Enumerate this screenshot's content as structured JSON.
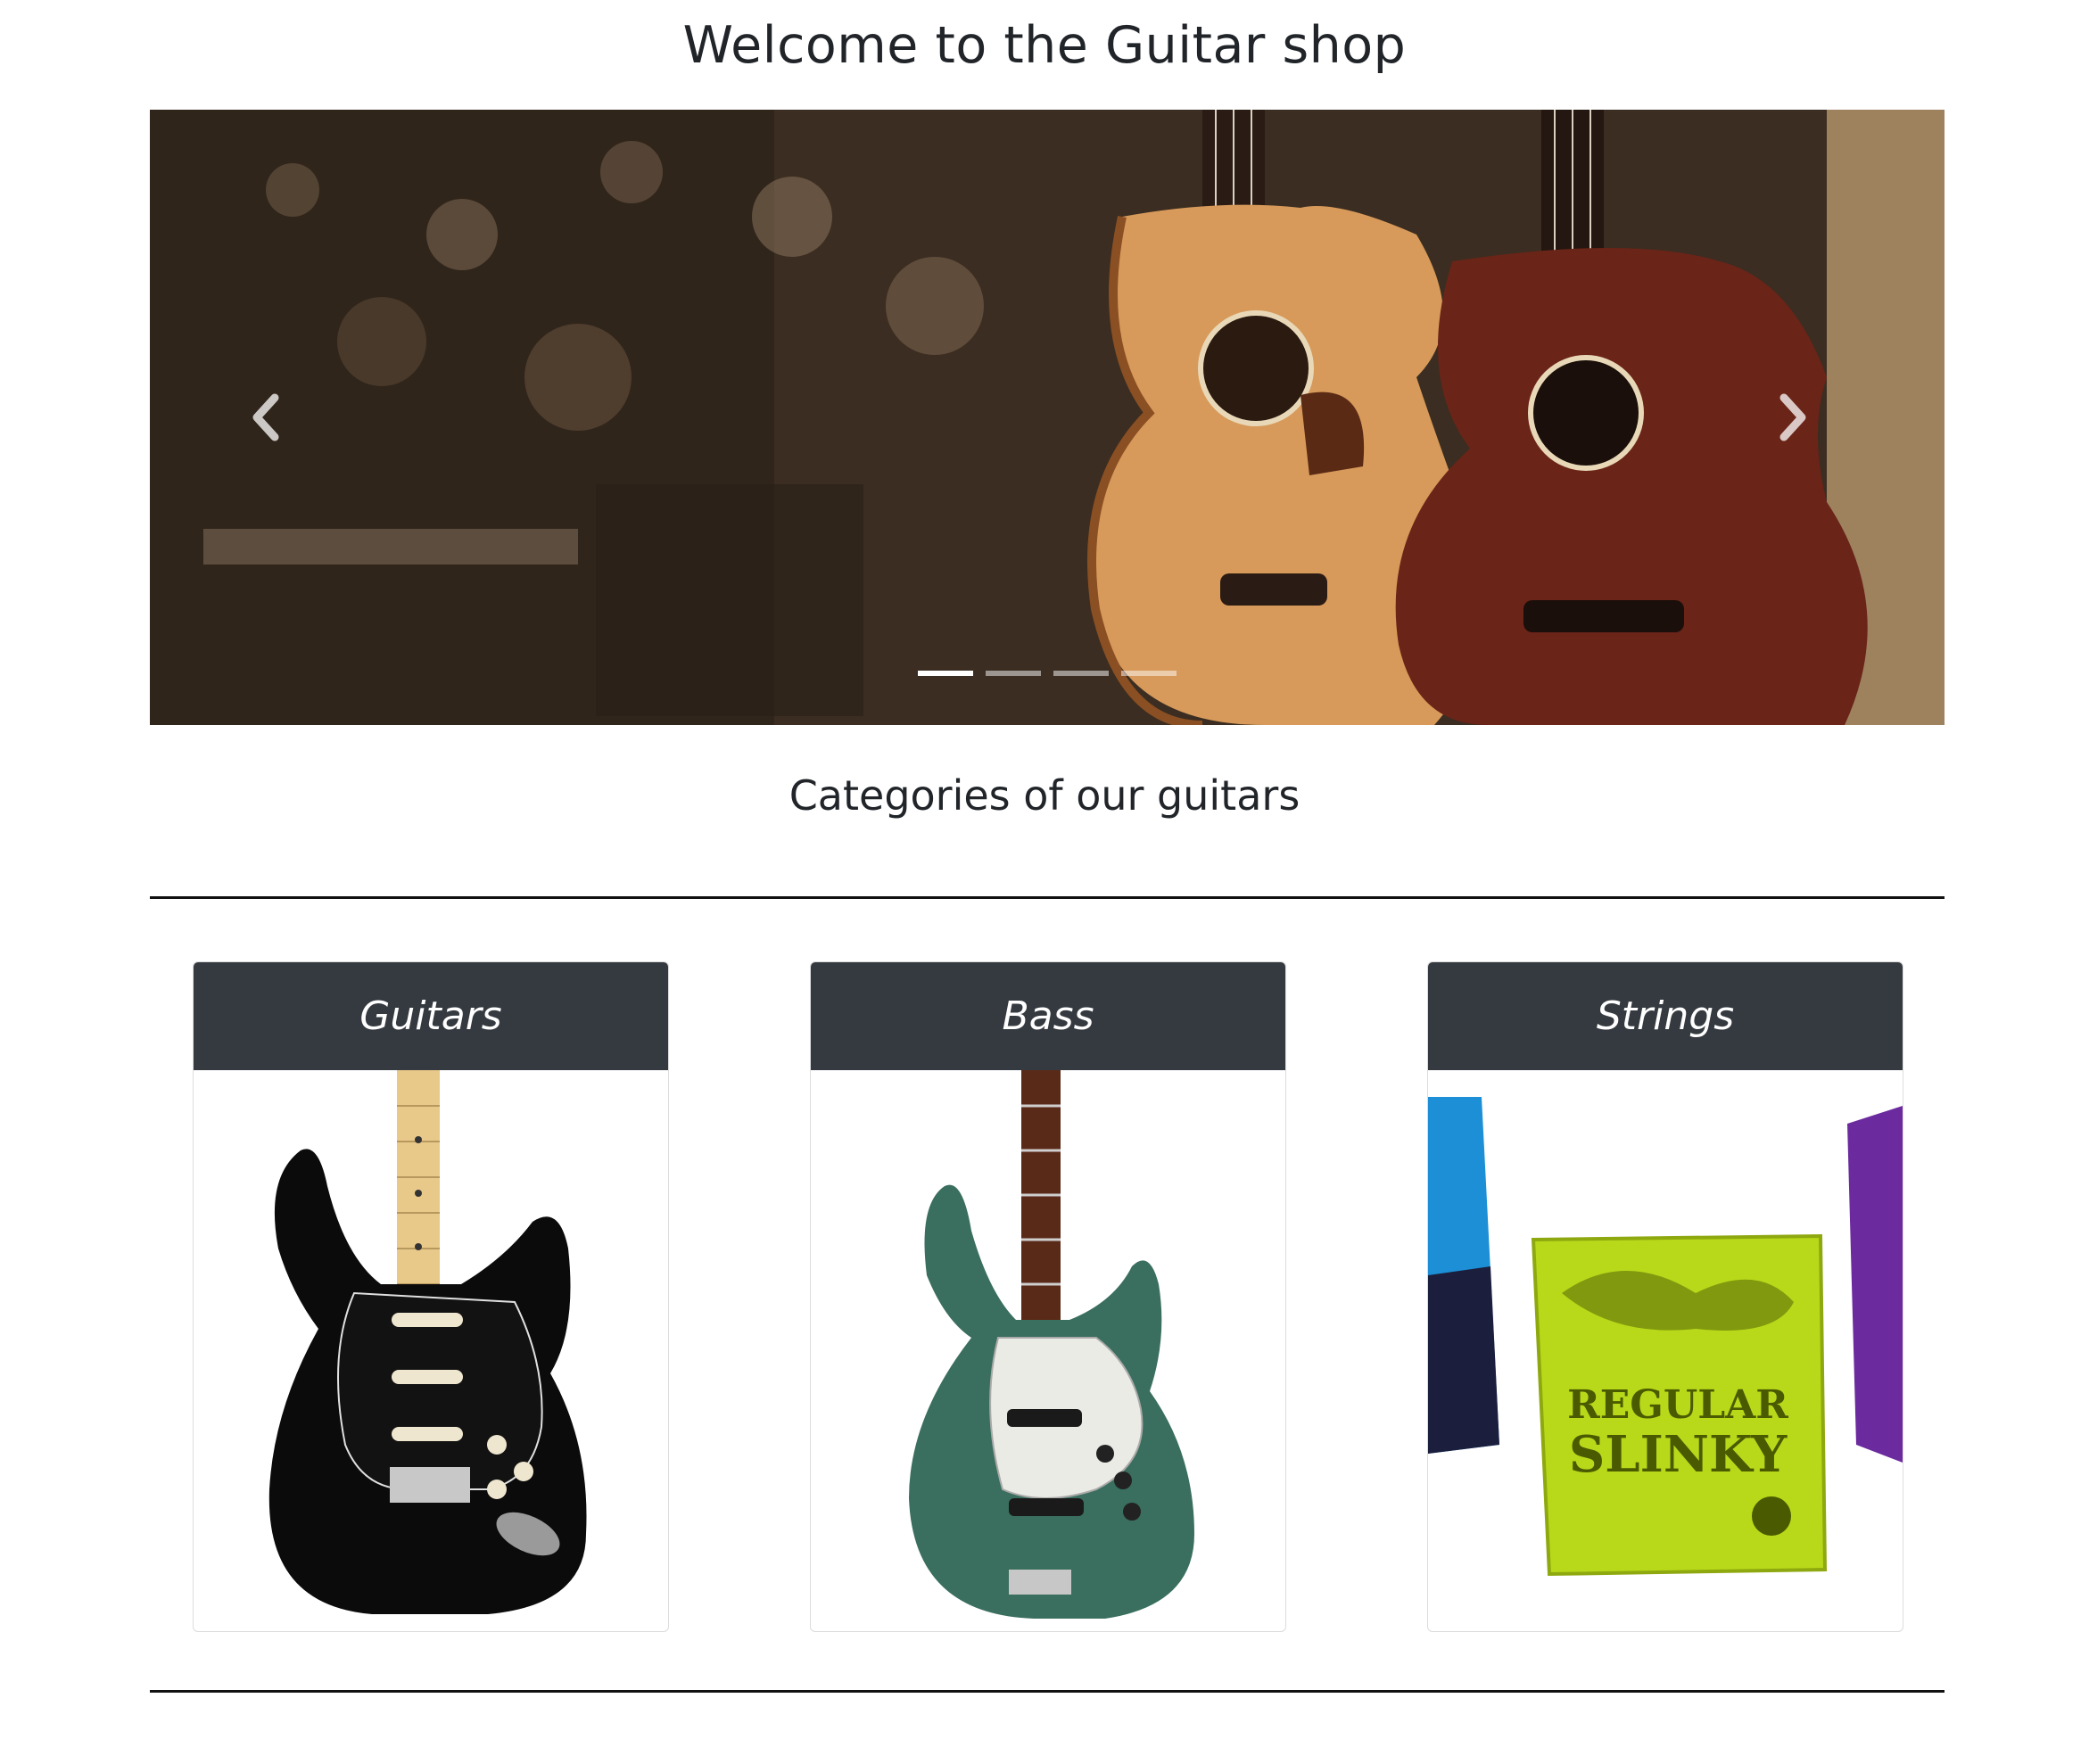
{
  "page": {
    "title": "Welcome to the Guitar shop",
    "categories_heading": "Categories of our guitars"
  },
  "carousel": {
    "prev_icon": "chevron-left-icon",
    "next_icon": "chevron-right-icon",
    "slide_count": 4,
    "active_slide": 1
  },
  "categories": [
    {
      "label": "Guitars"
    },
    {
      "label": "Bass"
    },
    {
      "label": "Strings"
    }
  ],
  "strings_pack": {
    "brand_line": "REGULAR",
    "product_line": "SLINKY"
  },
  "colors": {
    "card_header_bg": "#343a40",
    "card_header_text": "#ffffff",
    "divider": "#111111"
  }
}
